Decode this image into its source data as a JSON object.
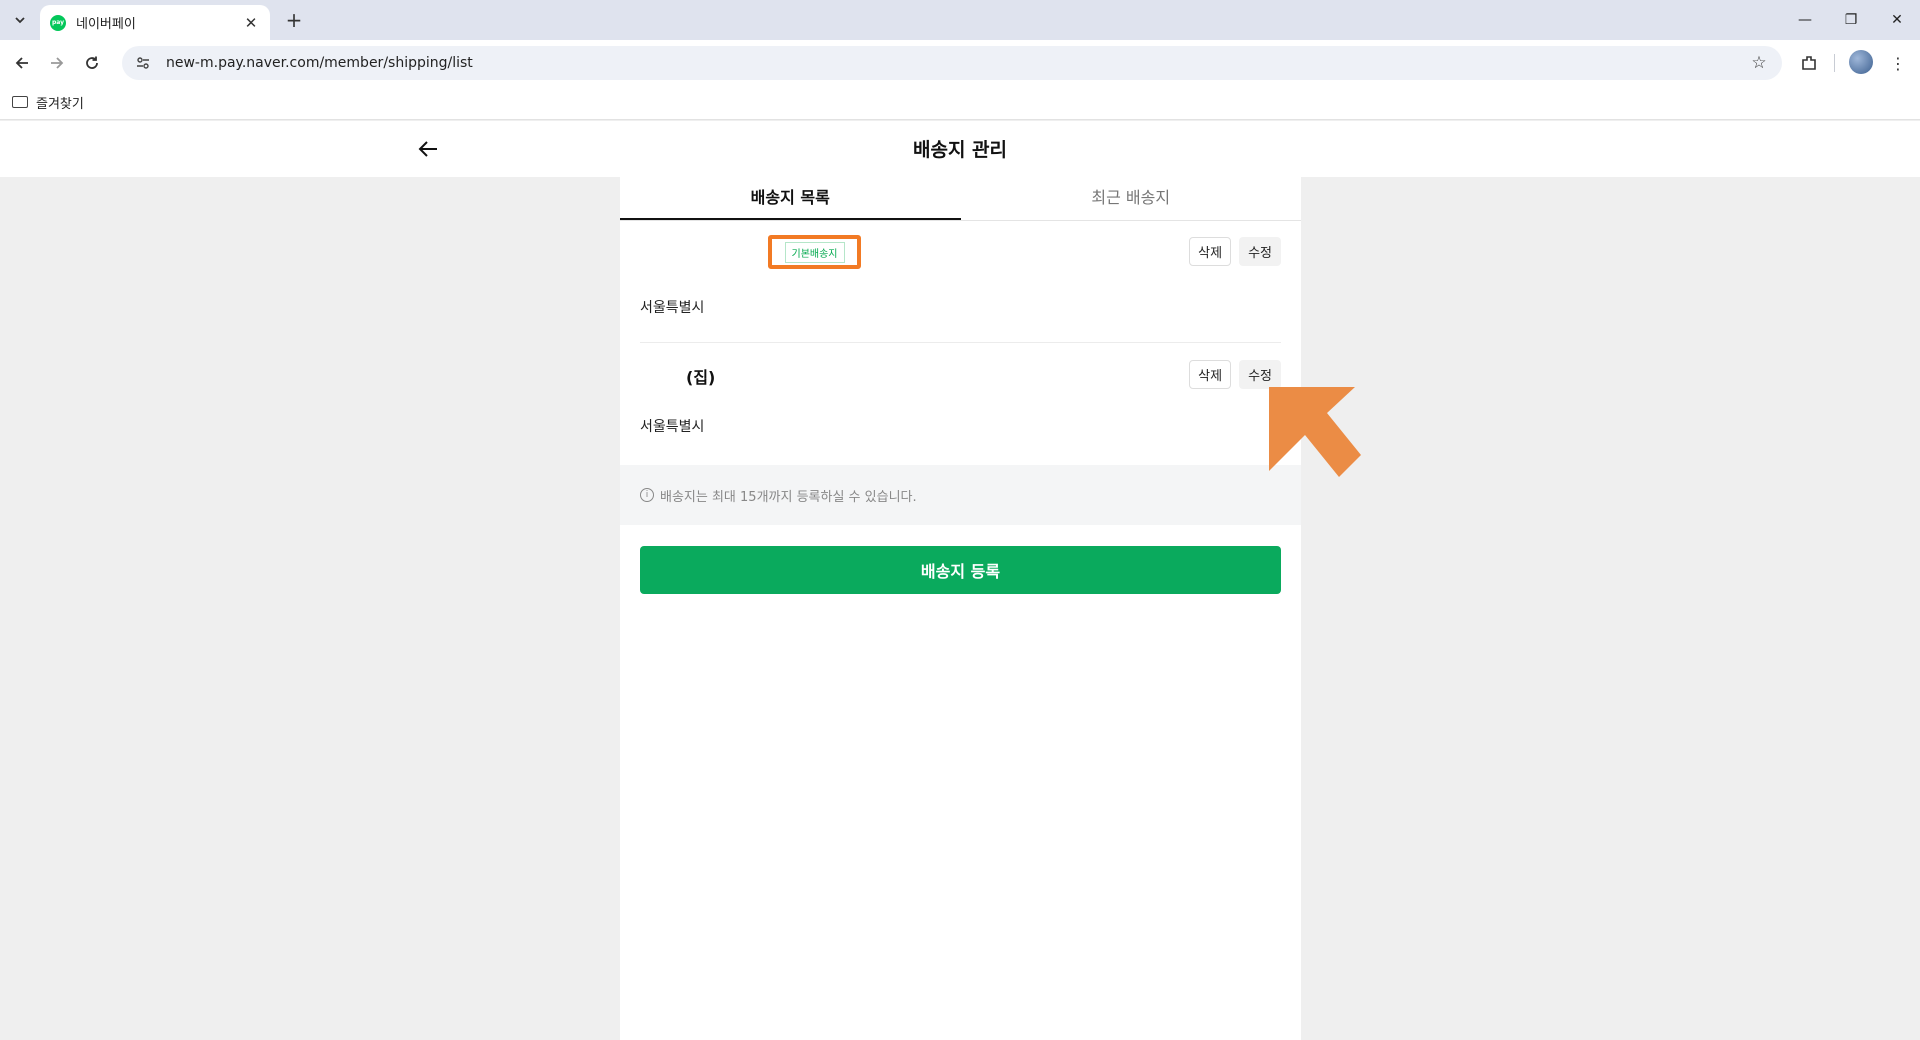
{
  "browser": {
    "tab_title": "네이버페이",
    "favicon_text": "pay",
    "url": "new-m.pay.naver.com/member/shipping/list",
    "bookmark_folder": "즐겨찾기"
  },
  "page": {
    "title": "배송지 관리",
    "tabs": [
      {
        "label": "배송지 목록",
        "active": true
      },
      {
        "label": "최근 배송지",
        "active": false
      }
    ],
    "addresses": [
      {
        "badge": "기본배송지",
        "address": "서울특별시",
        "delete_label": "삭제",
        "edit_label": "수정"
      },
      {
        "name": "(집)",
        "address": "서울특별시",
        "delete_label": "삭제",
        "edit_label": "수정"
      }
    ],
    "notice": "배송지는 최대 15개까지 등록하실 수 있습니다.",
    "register_button": "배송지 등록"
  },
  "colors": {
    "brand_green": "#0aaa5d",
    "highlight_orange": "#f27a24",
    "annotation_arrow": "#eb8c45"
  }
}
